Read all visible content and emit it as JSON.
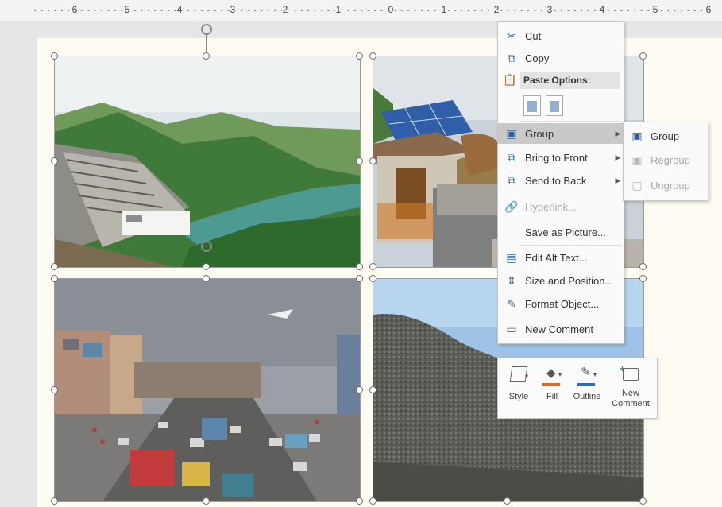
{
  "ruler": {
    "labels": [
      "6",
      "5",
      "4",
      "3",
      "2",
      "1",
      "0",
      "1",
      "2",
      "3",
      "4",
      "5",
      "6"
    ]
  },
  "context_menu": {
    "items": [
      {
        "label": "Cut",
        "icon": "scissors-icon"
      },
      {
        "label": "Copy",
        "icon": "copy-icon"
      },
      {
        "label": "Paste Options:",
        "icon": "paste-icon"
      },
      {
        "label": "Group",
        "icon": "group-icon",
        "submenu": true,
        "highlighted": true
      },
      {
        "label": "Bring to Front",
        "icon": "bring-to-front-icon",
        "submenu": true
      },
      {
        "label": "Send to Back",
        "icon": "send-to-back-icon",
        "submenu": true
      },
      {
        "label": "Hyperlink...",
        "icon": "hyperlink-icon",
        "disabled": true
      },
      {
        "label": "Save as Picture...",
        "icon": ""
      },
      {
        "label": "Edit Alt Text...",
        "icon": "alt-text-icon"
      },
      {
        "label": "Size and Position...",
        "icon": "size-position-icon"
      },
      {
        "label": "Format Object...",
        "icon": "format-object-icon"
      },
      {
        "label": "New Comment",
        "icon": "comment-icon"
      }
    ]
  },
  "group_submenu": {
    "items": [
      {
        "label": "Group",
        "disabled": false
      },
      {
        "label": "Regroup",
        "disabled": true
      },
      {
        "label": "Ungroup",
        "disabled": true
      }
    ]
  },
  "mini_toolbar": {
    "style_label": "Style",
    "fill_label": "Fill",
    "outline_label": "Outline",
    "comment_label_1": "New",
    "comment_label_2": "Comment"
  },
  "colors": {
    "accent_blue": "#2f5f9a",
    "fill_orange": "#e0672a",
    "outline_blue": "#2b6cc4",
    "menu_highlight": "#c9c9c9"
  }
}
